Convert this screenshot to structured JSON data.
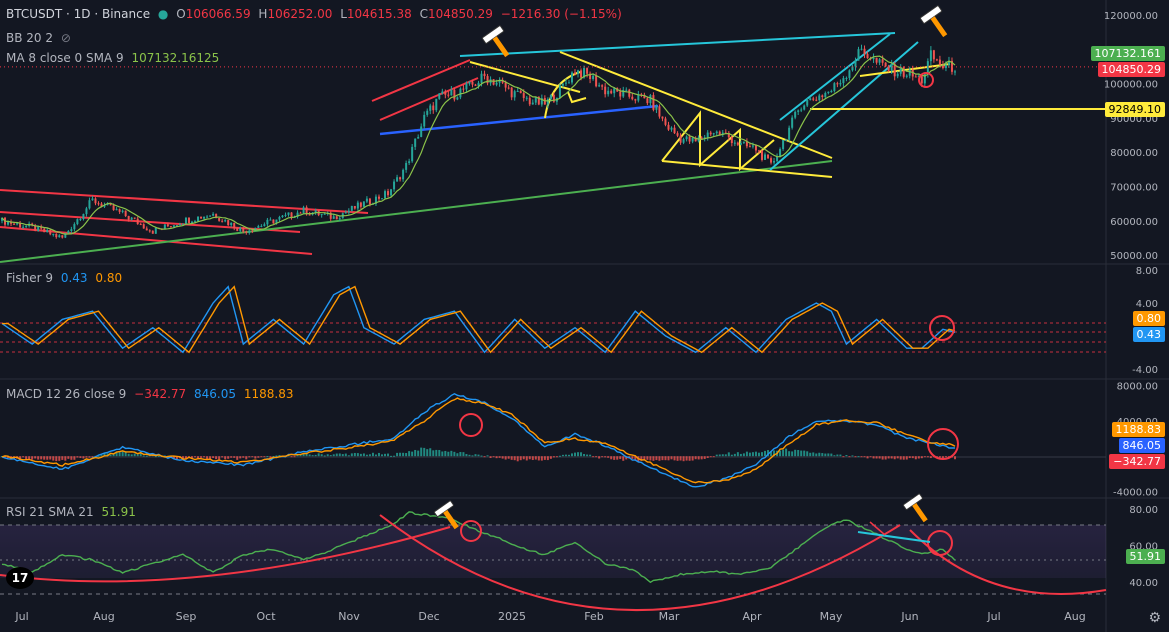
{
  "header": {
    "symbol": "BTCUSDT · 1D · Binance",
    "open_label": "O",
    "open": "106066.59",
    "high_label": "H",
    "high": "106252.00",
    "low_label": "L",
    "low": "104615.38",
    "close_label": "C",
    "close": "104850.29",
    "change": "−1216.30 (−1.15%)",
    "bb": "BB 20 2",
    "ma": "MA 8 close 0 SMA 9",
    "ma_value": "107132.16125"
  },
  "fisher": {
    "label": "Fisher 9",
    "v1": "0.43",
    "v2": "0.80"
  },
  "macd": {
    "label": "MACD 12 26 close 9",
    "hist": "−342.77",
    "macd": "846.05",
    "signal": "1188.83"
  },
  "rsi": {
    "label": "RSI 21 SMA 21",
    "value": "51.91"
  },
  "price_tags": {
    "ma": "107132.161",
    "last": "104850.29",
    "level": "92849.10"
  },
  "fisher_tags": {
    "a": "0.80",
    "b": "0.43"
  },
  "macd_tags": {
    "a": "1188.83",
    "b": "846.05",
    "c": "−342.77"
  },
  "rsi_tags": {
    "a": "51.91"
  },
  "logo_text": "17",
  "colors": {
    "bg": "#131722",
    "up": "#26a69a",
    "down": "#ef5350",
    "ma": "#8bc34a",
    "yellow": "#ffeb3b",
    "cyan": "#26c6da",
    "blue": "#2962ff",
    "green": "#4caf50",
    "red": "#f23645",
    "orange": "#ff9800"
  },
  "chart_data": [
    {
      "type": "candlestick",
      "pane": "price",
      "x_ticks": [
        "Jul",
        "Aug",
        "Sep",
        "Oct",
        "Nov",
        "Dec",
        "2025",
        "Feb",
        "Mar",
        "Apr",
        "May",
        "Jun",
        "Jul",
        "Aug"
      ],
      "y_ticks": [
        "120000.00",
        "110000.00",
        "100000.00",
        "90000.00",
        "80000.00",
        "70000.00",
        "60000.00",
        "50000.00"
      ],
      "ylim": [
        48000,
        122000
      ],
      "close_path": [
        [
          0,
          60000
        ],
        [
          10,
          58000
        ],
        [
          20,
          55000
        ],
        [
          30,
          66000
        ],
        [
          40,
          62000
        ],
        [
          50,
          57000
        ],
        [
          60,
          60000
        ],
        [
          70,
          62000
        ],
        [
          80,
          57000
        ],
        [
          90,
          60000
        ],
        [
          100,
          63000
        ],
        [
          110,
          61000
        ],
        [
          120,
          65000
        ],
        [
          128,
          68000
        ],
        [
          134,
          76000
        ],
        [
          140,
          90000
        ],
        [
          145,
          96000
        ],
        [
          150,
          97000
        ],
        [
          155,
          99000
        ],
        [
          160,
          102000
        ],
        [
          165,
          100000
        ],
        [
          170,
          97000
        ],
        [
          175,
          95000
        ],
        [
          180,
          94000
        ],
        [
          185,
          98000
        ],
        [
          190,
          104000
        ],
        [
          195,
          102000
        ],
        [
          200,
          98000
        ],
        [
          205,
          97000
        ],
        [
          210,
          96000
        ],
        [
          215,
          95000
        ],
        [
          220,
          88000
        ],
        [
          225,
          84000
        ],
        [
          230,
          83000
        ],
        [
          235,
          86000
        ],
        [
          240,
          85000
        ],
        [
          245,
          82000
        ],
        [
          250,
          81000
        ],
        [
          255,
          76000
        ],
        [
          260,
          85000
        ],
        [
          265,
          94000
        ],
        [
          270,
          96000
        ],
        [
          275,
          98000
        ],
        [
          280,
          103000
        ],
        [
          285,
          110000
        ],
        [
          290,
          106000
        ],
        [
          295,
          104000
        ],
        [
          300,
          103000
        ],
        [
          305,
          101000
        ],
        [
          308,
          108000
        ],
        [
          312,
          105000
        ],
        [
          316,
          104850
        ]
      ],
      "yellow_level": 92849.1
    },
    {
      "type": "line",
      "pane": "fisher",
      "y_ticks": [
        "8.00",
        "4.00",
        "-4.00"
      ],
      "ylim": [
        -5,
        8.5
      ],
      "series": [
        {
          "values": [
            [
              0,
              1.5
            ],
            [
              10,
              -1
            ],
            [
              20,
              2
            ],
            [
              30,
              3
            ],
            [
              40,
              -1.5
            ],
            [
              50,
              1
            ],
            [
              60,
              -2
            ],
            [
              70,
              4
            ],
            [
              75,
              6
            ],
            [
              80,
              -1
            ],
            [
              90,
              2
            ],
            [
              100,
              -1
            ],
            [
              110,
              5
            ],
            [
              115,
              6
            ],
            [
              120,
              1
            ],
            [
              130,
              -1
            ],
            [
              140,
              2
            ],
            [
              150,
              3
            ],
            [
              160,
              -2
            ],
            [
              170,
              2
            ],
            [
              180,
              -1.5
            ],
            [
              190,
              1
            ],
            [
              200,
              -2
            ],
            [
              210,
              3
            ],
            [
              220,
              0
            ],
            [
              230,
              -2
            ],
            [
              240,
              1
            ],
            [
              250,
              -2
            ],
            [
              260,
              2
            ],
            [
              270,
              4
            ],
            [
              275,
              3
            ],
            [
              280,
              -1
            ],
            [
              290,
              2
            ],
            [
              300,
              -1.5
            ],
            [
              305,
              -1.5
            ],
            [
              312,
              0.8
            ],
            [
              316,
              0.43
            ]
          ]
        }
      ]
    },
    {
      "type": "line",
      "pane": "macd",
      "y_ticks": [
        "8000.00",
        "4000.00",
        "-4000.00"
      ],
      "ylim": [
        -4500,
        8500
      ],
      "series": [
        {
          "values": [
            [
              0,
              -100
            ],
            [
              20,
              -1500
            ],
            [
              40,
              1000
            ],
            [
              60,
              -500
            ],
            [
              80,
              -1000
            ],
            [
              100,
              500
            ],
            [
              120,
              1500
            ],
            [
              130,
              2000
            ],
            [
              140,
              5000
            ],
            [
              150,
              7000
            ],
            [
              160,
              6000
            ],
            [
              170,
              4000
            ],
            [
              180,
              1000
            ],
            [
              190,
              2500
            ],
            [
              200,
              1200
            ],
            [
              210,
              -500
            ],
            [
              220,
              -2000
            ],
            [
              230,
              -3500
            ],
            [
              240,
              -2500
            ],
            [
              250,
              -1000
            ],
            [
              260,
              2000
            ],
            [
              270,
              4000
            ],
            [
              280,
              4000
            ],
            [
              290,
              3500
            ],
            [
              300,
              2000
            ],
            [
              308,
              1500
            ],
            [
              316,
              846.05
            ]
          ]
        },
        {
          "values": [
            [
              0,
              0
            ],
            [
              20,
              -1000
            ],
            [
              40,
              500
            ],
            [
              60,
              -200
            ],
            [
              80,
              -700
            ],
            [
              100,
              300
            ],
            [
              120,
              1200
            ],
            [
              130,
              1800
            ],
            [
              140,
              4000
            ],
            [
              150,
              6500
            ],
            [
              160,
              6000
            ],
            [
              170,
              4500
            ],
            [
              180,
              1500
            ],
            [
              190,
              2000
            ],
            [
              200,
              1500
            ],
            [
              210,
              0
            ],
            [
              220,
              -1500
            ],
            [
              230,
              -3000
            ],
            [
              240,
              -2800
            ],
            [
              250,
              -1500
            ],
            [
              260,
              1200
            ],
            [
              270,
              3600
            ],
            [
              280,
              4000
            ],
            [
              290,
              3800
            ],
            [
              300,
              2400
            ],
            [
              308,
              1600
            ],
            [
              316,
              1188.83
            ]
          ]
        }
      ]
    },
    {
      "type": "line",
      "pane": "rsi",
      "y_ticks": [
        "80.00",
        "60.00",
        "40.00"
      ],
      "ylim": [
        30,
        85
      ],
      "series": [
        {
          "values": [
            [
              0,
              50
            ],
            [
              10,
              45
            ],
            [
              20,
              55
            ],
            [
              30,
              52
            ],
            [
              40,
              45
            ],
            [
              50,
              50
            ],
            [
              60,
              55
            ],
            [
              70,
              45
            ],
            [
              80,
              55
            ],
            [
              90,
              58
            ],
            [
              100,
              52
            ],
            [
              110,
              58
            ],
            [
              120,
              65
            ],
            [
              130,
              72
            ],
            [
              135,
              78
            ],
            [
              145,
              76
            ],
            [
              150,
              74
            ],
            [
              155,
              70
            ],
            [
              165,
              64
            ],
            [
              170,
              60
            ],
            [
              180,
              55
            ],
            [
              190,
              62
            ],
            [
              200,
              50
            ],
            [
              210,
              46
            ],
            [
              215,
              40
            ],
            [
              225,
              44
            ],
            [
              235,
              46
            ],
            [
              245,
              44
            ],
            [
              255,
              48
            ],
            [
              265,
              60
            ],
            [
              275,
              72
            ],
            [
              280,
              74
            ],
            [
              290,
              66
            ],
            [
              300,
              58
            ],
            [
              305,
              55
            ],
            [
              312,
              58
            ],
            [
              316,
              51.91
            ]
          ]
        }
      ]
    }
  ]
}
